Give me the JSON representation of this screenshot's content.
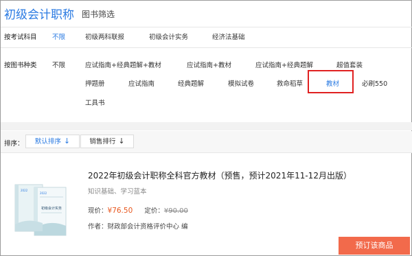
{
  "header": {
    "title": "初级会计职称",
    "subtitle": "图书筛选"
  },
  "subject_filter": {
    "label": "按考试科目",
    "options": [
      "不限",
      "初级两科联报",
      "初级会计实务",
      "经济法基础"
    ],
    "active": "不限"
  },
  "type_filter": {
    "label": "按图书种类",
    "options": [
      "不限",
      "应试指南+经典题解+教材",
      "应试指南+教材",
      "应试指南+经典题解",
      "超值套装",
      "押题册",
      "应试指南",
      "经典题解",
      "模拟试卷",
      "救命稻草",
      "教材",
      "必刷550",
      "工具书"
    ],
    "highlighted": "教材"
  },
  "sort": {
    "label": "排序：",
    "options": [
      "默认排序",
      "销售排行"
    ],
    "active": "默认排序"
  },
  "product": {
    "title": "2022年初级会计职称全科官方教材（预售，预计2021年11-12月出版）",
    "desc": "知识基础、学习蓝本",
    "price_label": "现价：",
    "price": "¥76.50",
    "list_label": "定价：",
    "list_price": "¥90.00",
    "author_label": "作者：",
    "author": "财政部会计资格评价中心 编",
    "cover_text": "初级会计实务",
    "order_button": "预订该商品"
  },
  "colors": {
    "accent": "#2a7ae2",
    "highlight": "#e02020",
    "price": "#e8571e",
    "button": "#f26a4b"
  },
  "icons": {
    "sort_arrow": "arrow-down-icon"
  }
}
